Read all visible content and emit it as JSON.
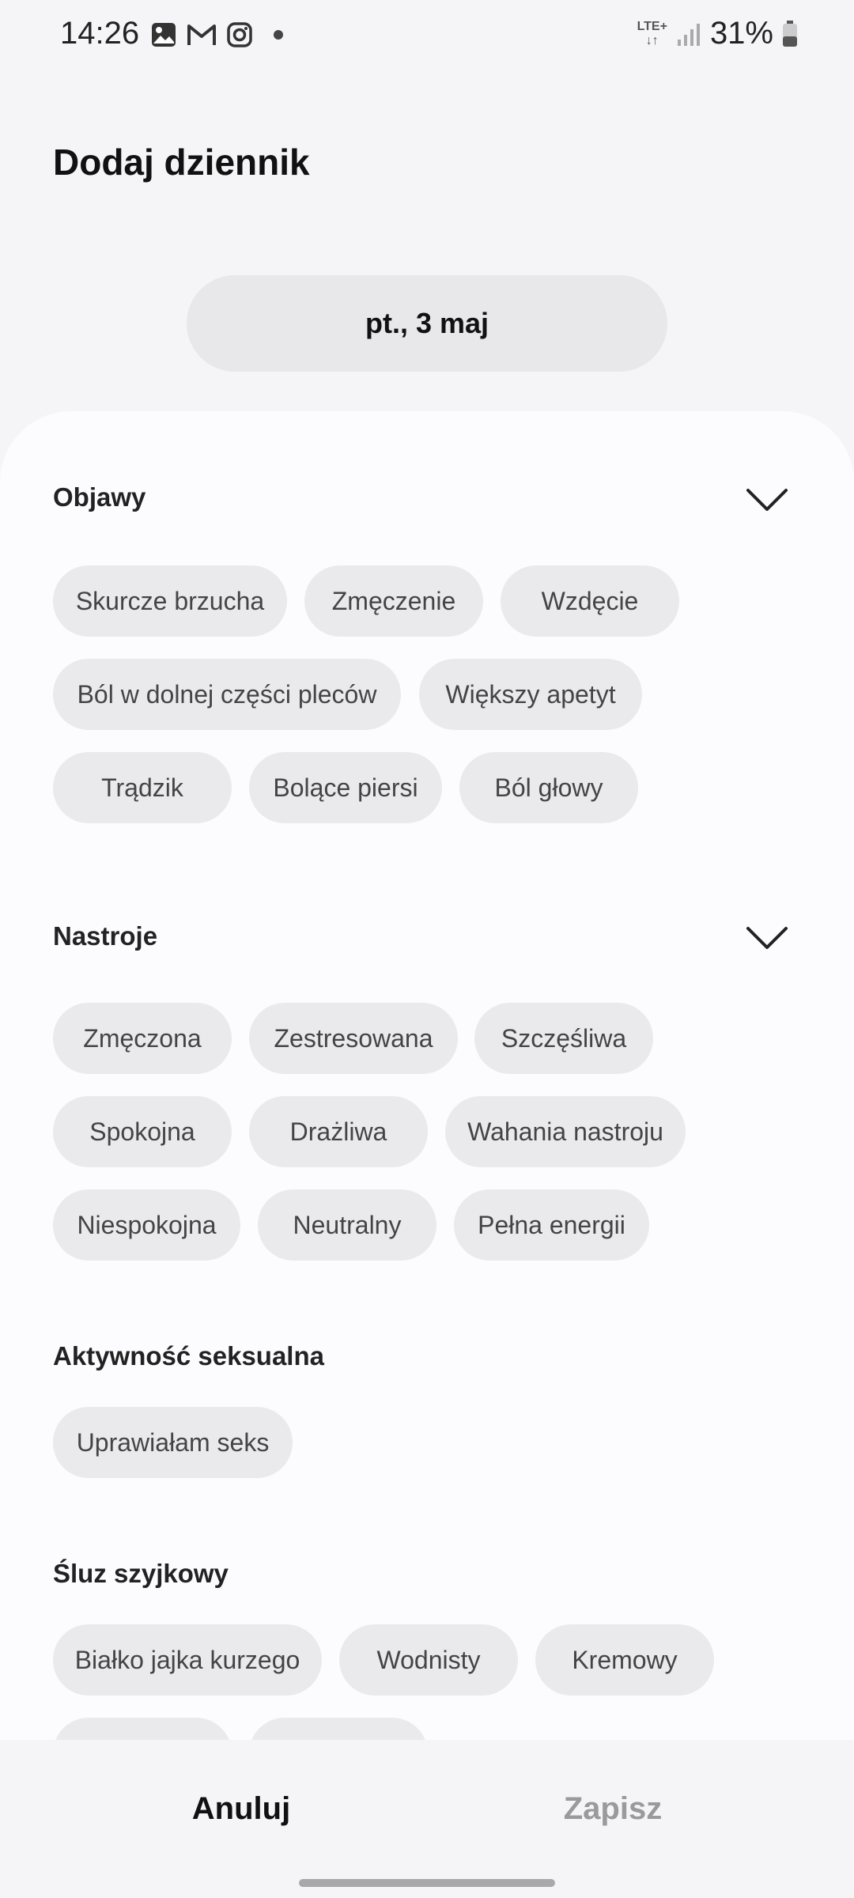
{
  "status": {
    "time": "14:26",
    "network": "LTE+",
    "battery": "31%"
  },
  "header": {
    "title": "Dodaj dziennik",
    "date": "pt., 3 maj"
  },
  "sections": {
    "symptoms": {
      "title": "Objawy",
      "chips": [
        "Skurcze brzucha",
        "Zmęczenie",
        "Wzdęcie",
        "Ból w dolnej części pleców",
        "Większy apetyt",
        "Trądzik",
        "Bolące piersi",
        "Ból głowy"
      ]
    },
    "moods": {
      "title": "Nastroje",
      "chips": [
        "Zmęczona",
        "Zestresowana",
        "Szczęśliwa",
        "Spokojna",
        "Drażliwa",
        "Wahania nastroju",
        "Niespokojna",
        "Neutralny",
        "Pełna energii"
      ]
    },
    "sexual": {
      "title": "Aktywność seksualna",
      "chips": [
        "Uprawiałam seks"
      ]
    },
    "mucus": {
      "title": "Śluz szyjkowy",
      "chips": [
        "Białko jajka kurzego",
        "Wodnisty",
        "Kremowy"
      ]
    }
  },
  "actions": {
    "cancel": "Anuluj",
    "save": "Zapisz"
  },
  "colors": {
    "background": "#f5f5f7",
    "sheet": "#fcfcfe",
    "chip": "#eaeaec",
    "disabled_text": "#9a9a9c"
  }
}
